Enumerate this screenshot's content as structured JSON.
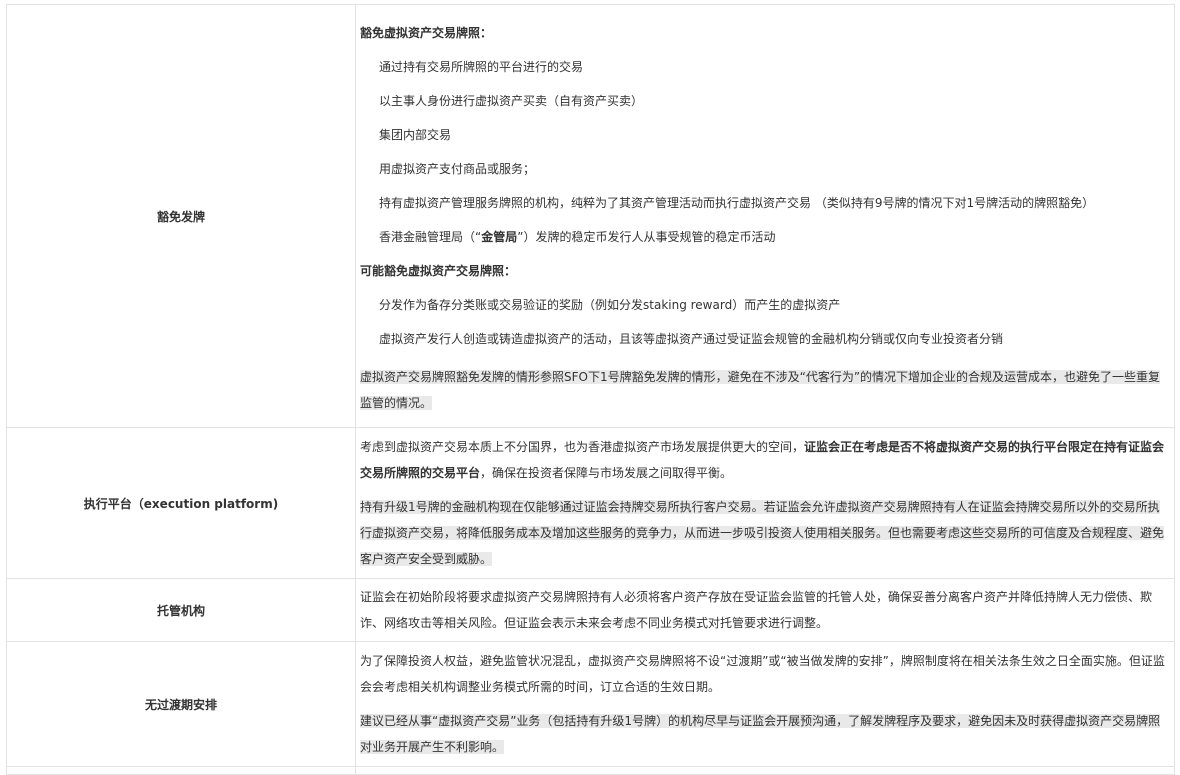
{
  "rows": [
    {
      "label": "豁免发牌",
      "heading1": "豁免虚拟资产交易牌照：",
      "items1": [
        "通过持有交易所牌照的平台进行的交易",
        "以主事人身份进行虚拟资产买卖（自有资产买卖）",
        "集团内部交易",
        "用虚拟资产支付商品或服务；",
        "持有虚拟资产管理服务牌照的机构，纯粹为了其资产管理活动而执行虚拟资产交易 （类似持有9号牌的情况下对1号牌活动的牌照豁免）"
      ],
      "item_hkma_pre": "香港金融管理局（“",
      "item_hkma_bold": "金管局",
      "item_hkma_post": "”）发牌的稳定币发行人从事受规管的稳定币活动",
      "heading2": "可能豁免虚拟资产交易牌照：",
      "items2": [
        "分发作为备存分类账或交易验证的奖励（例如分发staking reward）而产生的虚拟资产",
        "虚拟资产发行人创造或铸造虚拟资产的活动，且该等虚拟资产通过受证监会规管的金融机构分销或仅向专业投资者分销"
      ],
      "note": "虚拟资产交易牌照豁免发牌的情形参照SFO下1号牌豁免发牌的情形，避免在不涉及“代客行为”的情况下增加企业的合规及运营成本，也避免了一些重复监管的情况。"
    },
    {
      "label": "执行平台（execution platform)",
      "p1_pre": "考虑到虚拟资产交易本质上不分国界，也为香港虚拟资产市场发展提供更大的空间，",
      "p1_bold": "证监会正在考虑是否不将虚拟资产交易的执行平台限定在持有证监会交易所牌照的交易平台",
      "p1_post": "，确保在投资者保障与市场发展之间取得平衡。",
      "p2": "持有升级1号牌的金融机构现在仅能够通过证监会持牌交易所执行客户交易。若证监会允许虚拟资产交易牌照持有人在证监会持牌交易所以外的交易所执行虚拟资产交易，将降低服务成本及增加这些服务的竞争力，从而进一步吸引投资人使用相关服务。但也需要考虑这些交易所的可信度及合规程度、避免客户资产安全受到威胁。"
    },
    {
      "label": "托管机构",
      "p1": "证监会在初始阶段将要求虚拟资产交易牌照持有人必须将客户资产存放在受证监会监管的托管人处，确保妥善分离客户资产并降低持牌人无力偿债、欺诈、网络攻击等相关风险。但证监会表示未来会考虑不同业务模式对托管要求进行调整。"
    },
    {
      "label": "无过渡期安排",
      "p1": "为了保障投资人权益，避免监管状况混乱，虚拟资产交易牌照将不设“过渡期”或“被当做发牌的安排”，牌照制度将在相关法条生效之日全面实施。但证监会会考虑相关机构调整业务模式所需的时间，订立合适的生效日期。",
      "p2": "建议已经从事“虚拟资产交易”业务（包括持有升级1号牌）的机构尽早与证监会开展预沟通，了解发牌程序及要求，避免因未及时获得虚拟资产交易牌照对业务开展产生不利影响。"
    }
  ]
}
